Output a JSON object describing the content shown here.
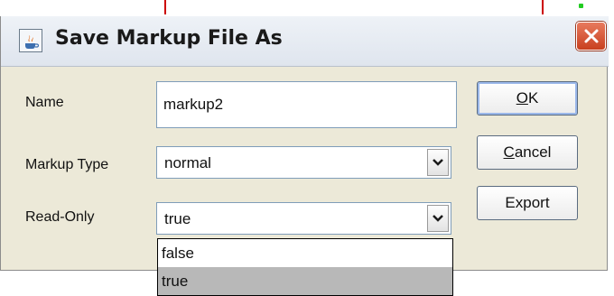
{
  "window": {
    "title": "Save Markup File As",
    "title_icon": "java-cup-icon",
    "close_icon": "close-x-icon"
  },
  "form": {
    "name_label": "Name",
    "name_value": "markup2",
    "markup_type_label": "Markup Type",
    "markup_type_value": "normal",
    "read_only_label": "Read-Only",
    "read_only_value": "true"
  },
  "buttons": {
    "ok_mnemonic": "O",
    "ok_rest": "K",
    "cancel_mnemonic": "C",
    "cancel_rest": "ancel",
    "export_label": "Export"
  },
  "dropdown": {
    "options": [
      "false",
      "true"
    ],
    "selected": "true"
  },
  "colors": {
    "accent": "#9bb8ea",
    "close_button": "#c8401f",
    "selection": "#b8b8b8"
  }
}
